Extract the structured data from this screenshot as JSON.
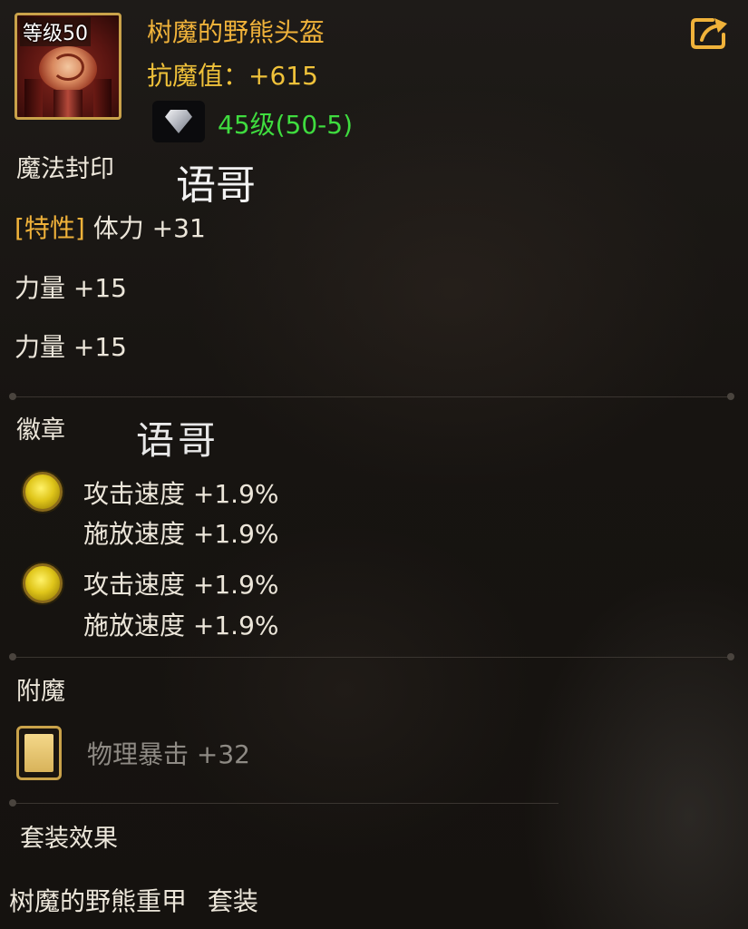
{
  "item": {
    "level_badge": "等级50",
    "name": "树魔的野熊头盔",
    "main_stat": "抗魔值：+615",
    "gem_text": "45级(50-5)",
    "icon": "bear-helmet-icon"
  },
  "sections": {
    "magic_seal": "魔法封印",
    "badge": "徽章",
    "enchant": "附魔",
    "set_effect": "套装效果"
  },
  "watermarks": [
    "语哥",
    "语哥"
  ],
  "magic_seal_stats": {
    "trait_tag": "[特性]",
    "trait_value": "体力 +31",
    "lines": [
      "力量 +15",
      "力量 +15"
    ]
  },
  "badges": [
    {
      "line1": "攻击速度 +1.9%",
      "line2": "施放速度 +1.9%",
      "icon": "gold-orb-icon"
    },
    {
      "line1": "攻击速度 +1.9%",
      "line2": "施放速度 +1.9%",
      "icon": "gold-orb-icon"
    }
  ],
  "enchant": {
    "text": "物理暴击 +32",
    "icon": "enchant-card-icon"
  },
  "set": {
    "name": "树魔的野熊重甲",
    "suffix": "套装"
  },
  "colors": {
    "gold": "#f0b23a",
    "green": "#3fdc3f",
    "gray_text": "#8e8a84",
    "text": "#ece6da"
  }
}
